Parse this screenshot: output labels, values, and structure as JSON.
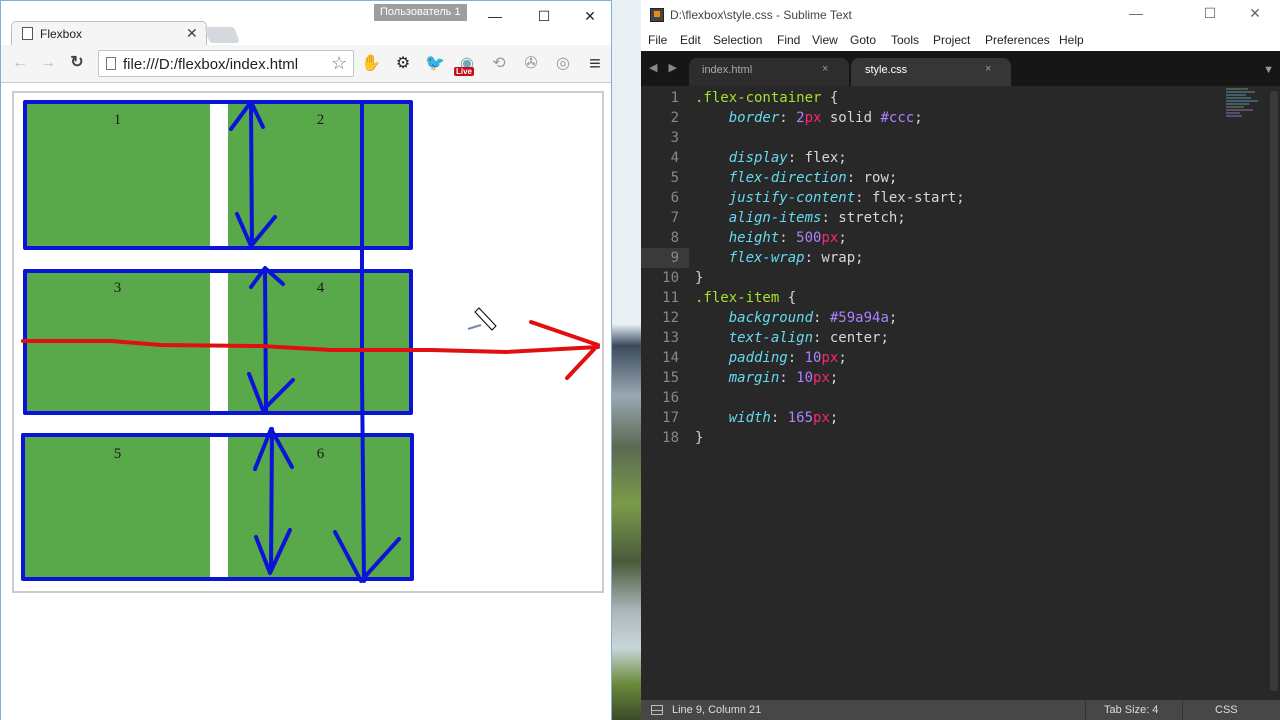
{
  "browser": {
    "profile_badge": "Пользователь 1",
    "window_controls": {
      "minimize": "—",
      "maximize": "☐",
      "close": "✕"
    },
    "tab": {
      "title": "Flexbox",
      "close": "✕",
      "icon": "page-icon"
    },
    "toolbar": {
      "back": "←",
      "forward": "→",
      "reload": "↻",
      "url": "file:///D:/flexbox/index.html",
      "star": "☆",
      "extensions": [
        {
          "name": "opera-stop-icon",
          "glyph": "✋",
          "color": "#d0101a"
        },
        {
          "name": "settings-gear-icon",
          "glyph": "⚙",
          "color": "#222222"
        },
        {
          "name": "bird-extension-icon",
          "glyph": "🐦",
          "color": "#3fa0d8"
        },
        {
          "name": "live-extension-icon",
          "glyph": "◉",
          "color": "#6fa8b8"
        },
        {
          "name": "history-icon",
          "glyph": "⟲",
          "color": "#9a9a9a"
        },
        {
          "name": "robot-extension-icon",
          "glyph": "✇",
          "color": "#9a9a9a"
        },
        {
          "name": "circle-extension-icon",
          "glyph": "◎",
          "color": "#9a9a9a"
        }
      ],
      "live_badge": "Live",
      "menu": "≡"
    },
    "page": {
      "items": [
        "1",
        "2",
        "3",
        "4",
        "5",
        "6"
      ],
      "item_color": "#59a94a",
      "border_color": "#cccccc",
      "annotation_colors": {
        "blue": "#0a14d8",
        "red": "#e01010"
      }
    }
  },
  "editor": {
    "title": "D:\\flexbox\\style.css - Sublime Text",
    "window_controls": {
      "minimize": "—",
      "maximize": "☐",
      "close": "✕"
    },
    "menu": [
      "File",
      "Edit",
      "Selection",
      "Find",
      "View",
      "Goto",
      "Tools",
      "Project",
      "Preferences",
      "Help"
    ],
    "tabs": [
      {
        "label": "index.html",
        "close": "×",
        "active": false
      },
      {
        "label": "style.css",
        "close": "×",
        "active": true
      }
    ],
    "tab_nav": "◀ ▶",
    "tab_dropdown": "▼",
    "line_numbers": [
      "1",
      "2",
      "3",
      "4",
      "5",
      "6",
      "7",
      "8",
      "9",
      "10",
      "11",
      "12",
      "13",
      "14",
      "15",
      "16",
      "17",
      "18"
    ],
    "code": [
      [
        {
          "t": ".flex-container",
          "c": "sel"
        },
        {
          "t": " {",
          "c": "val"
        }
      ],
      [
        {
          "t": "    ",
          "c": "val"
        },
        {
          "t": "border",
          "c": "prop"
        },
        {
          "t": ": ",
          "c": "val"
        },
        {
          "t": "2",
          "c": "num"
        },
        {
          "t": "px",
          "c": "unit"
        },
        {
          "t": " solid ",
          "c": "val"
        },
        {
          "t": "#ccc",
          "c": "num"
        },
        {
          "t": ";",
          "c": "val"
        }
      ],
      [],
      [
        {
          "t": "    ",
          "c": "val"
        },
        {
          "t": "display",
          "c": "prop"
        },
        {
          "t": ": flex;",
          "c": "val"
        }
      ],
      [
        {
          "t": "    ",
          "c": "val"
        },
        {
          "t": "flex-direction",
          "c": "prop"
        },
        {
          "t": ": row;",
          "c": "val"
        }
      ],
      [
        {
          "t": "    ",
          "c": "val"
        },
        {
          "t": "justify-content",
          "c": "prop"
        },
        {
          "t": ": flex-start;",
          "c": "val"
        }
      ],
      [
        {
          "t": "    ",
          "c": "val"
        },
        {
          "t": "align-items",
          "c": "prop"
        },
        {
          "t": ": stretch;",
          "c": "val"
        }
      ],
      [
        {
          "t": "    ",
          "c": "val"
        },
        {
          "t": "height",
          "c": "prop"
        },
        {
          "t": ": ",
          "c": "val"
        },
        {
          "t": "500",
          "c": "num"
        },
        {
          "t": "px",
          "c": "unit"
        },
        {
          "t": ";",
          "c": "val"
        }
      ],
      [
        {
          "t": "    ",
          "c": "val"
        },
        {
          "t": "flex-wrap",
          "c": "prop"
        },
        {
          "t": ": wrap;",
          "c": "val"
        }
      ],
      [
        {
          "t": "}",
          "c": "val"
        }
      ],
      [
        {
          "t": ".flex-item",
          "c": "sel"
        },
        {
          "t": " {",
          "c": "val"
        }
      ],
      [
        {
          "t": "    ",
          "c": "val"
        },
        {
          "t": "background",
          "c": "prop"
        },
        {
          "t": ": ",
          "c": "val"
        },
        {
          "t": "#59a94a",
          "c": "num"
        },
        {
          "t": ";",
          "c": "val"
        }
      ],
      [
        {
          "t": "    ",
          "c": "val"
        },
        {
          "t": "text-align",
          "c": "prop"
        },
        {
          "t": ": center;",
          "c": "val"
        }
      ],
      [
        {
          "t": "    ",
          "c": "val"
        },
        {
          "t": "padding",
          "c": "prop"
        },
        {
          "t": ": ",
          "c": "val"
        },
        {
          "t": "10",
          "c": "num"
        },
        {
          "t": "px",
          "c": "unit"
        },
        {
          "t": ";",
          "c": "val"
        }
      ],
      [
        {
          "t": "    ",
          "c": "val"
        },
        {
          "t": "margin",
          "c": "prop"
        },
        {
          "t": ": ",
          "c": "val"
        },
        {
          "t": "10",
          "c": "num"
        },
        {
          "t": "px",
          "c": "unit"
        },
        {
          "t": ";",
          "c": "val"
        }
      ],
      [],
      [
        {
          "t": "    ",
          "c": "val"
        },
        {
          "t": "width",
          "c": "prop"
        },
        {
          "t": ": ",
          "c": "val"
        },
        {
          "t": "165",
          "c": "num"
        },
        {
          "t": "px",
          "c": "unit"
        },
        {
          "t": ";",
          "c": "val"
        }
      ],
      [
        {
          "t": "}",
          "c": "val"
        }
      ]
    ],
    "status": {
      "position": "Line 9, Column 21",
      "tab_size": "Tab Size: 4",
      "syntax": "CSS"
    }
  }
}
